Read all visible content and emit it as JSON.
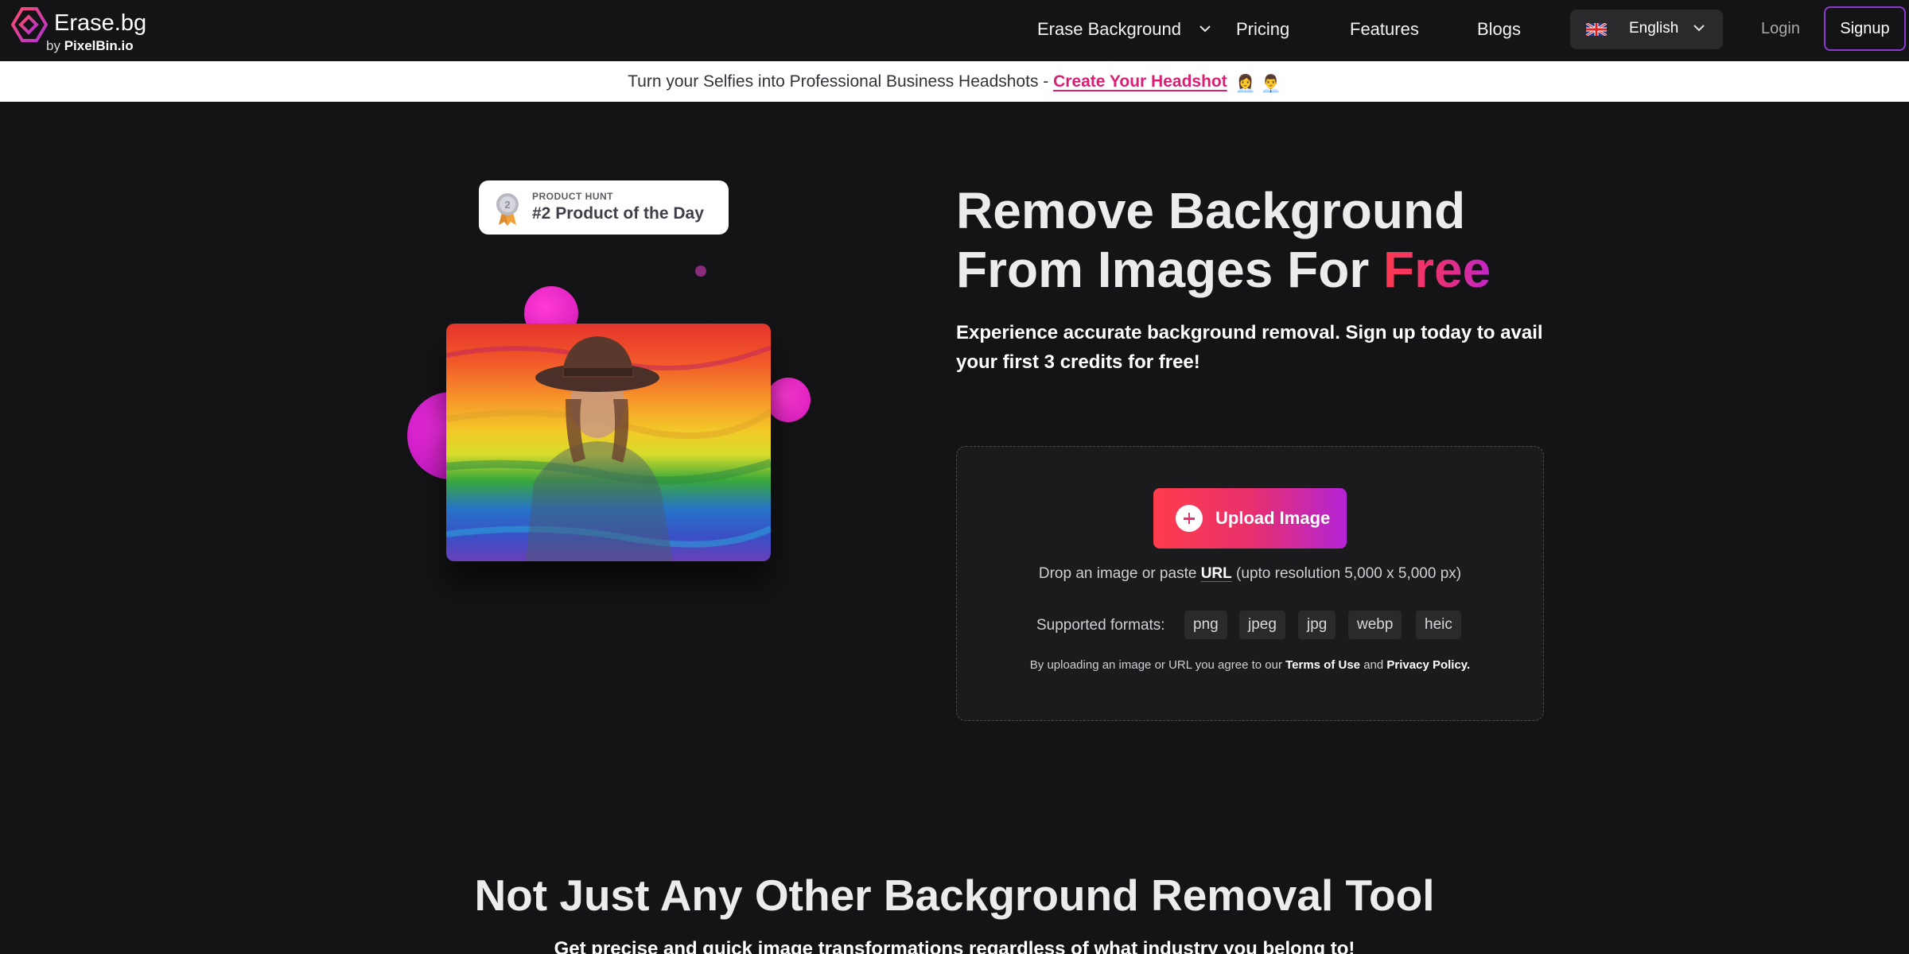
{
  "header": {
    "logo": {
      "name": "Erase.bg",
      "by_prefix": "by",
      "by_brand": "PixelBin.io"
    },
    "nav": [
      {
        "label": "Erase Background",
        "has_caret": true
      },
      {
        "label": "Pricing"
      },
      {
        "label": "Features"
      },
      {
        "label": "Blogs"
      }
    ],
    "language": {
      "label": "English",
      "flag_icon": "uk-flag-icon"
    },
    "login": "Login",
    "signup": "Signup"
  },
  "banner": {
    "text": "Turn your Selfies into Professional Business Headshots - ",
    "link": "Create Your Headshot",
    "emojis": "👩‍💼 👨‍💼"
  },
  "badge": {
    "small": "PRODUCT HUNT",
    "big": "#2 Product of the Day",
    "medal_number": "2"
  },
  "hero": {
    "title_line1": "Remove Background",
    "title_line2_prefix": "From Images For ",
    "title_highlight": "Free",
    "subtitle": "Experience accurate background removal. Sign up today to avail your first 3 credits for free!"
  },
  "upload": {
    "button": "Upload Image",
    "drop_prefix": "Drop an image or paste ",
    "drop_url": "URL",
    "drop_suffix": " (upto resolution 5,000 x 5,000 px)",
    "formats_label": "Supported formats:",
    "formats": [
      "png",
      "jpeg",
      "jpg",
      "webp",
      "heic"
    ],
    "terms_prefix": "By uploading an image or URL you agree to our ",
    "terms_link": "Terms of Use",
    "terms_and": " and ",
    "privacy_link": "Privacy Policy."
  },
  "section2": {
    "title": "Not Just Any Other Background Removal Tool",
    "subtitle": "Get precise and quick image transformations regardless of what industry you belong to!"
  },
  "colors": {
    "background": "#141315",
    "accent_pink": "#e8306c",
    "accent_red": "#ff3c4b",
    "accent_purple": "#b424d8",
    "banner_link": "#d81f74"
  }
}
